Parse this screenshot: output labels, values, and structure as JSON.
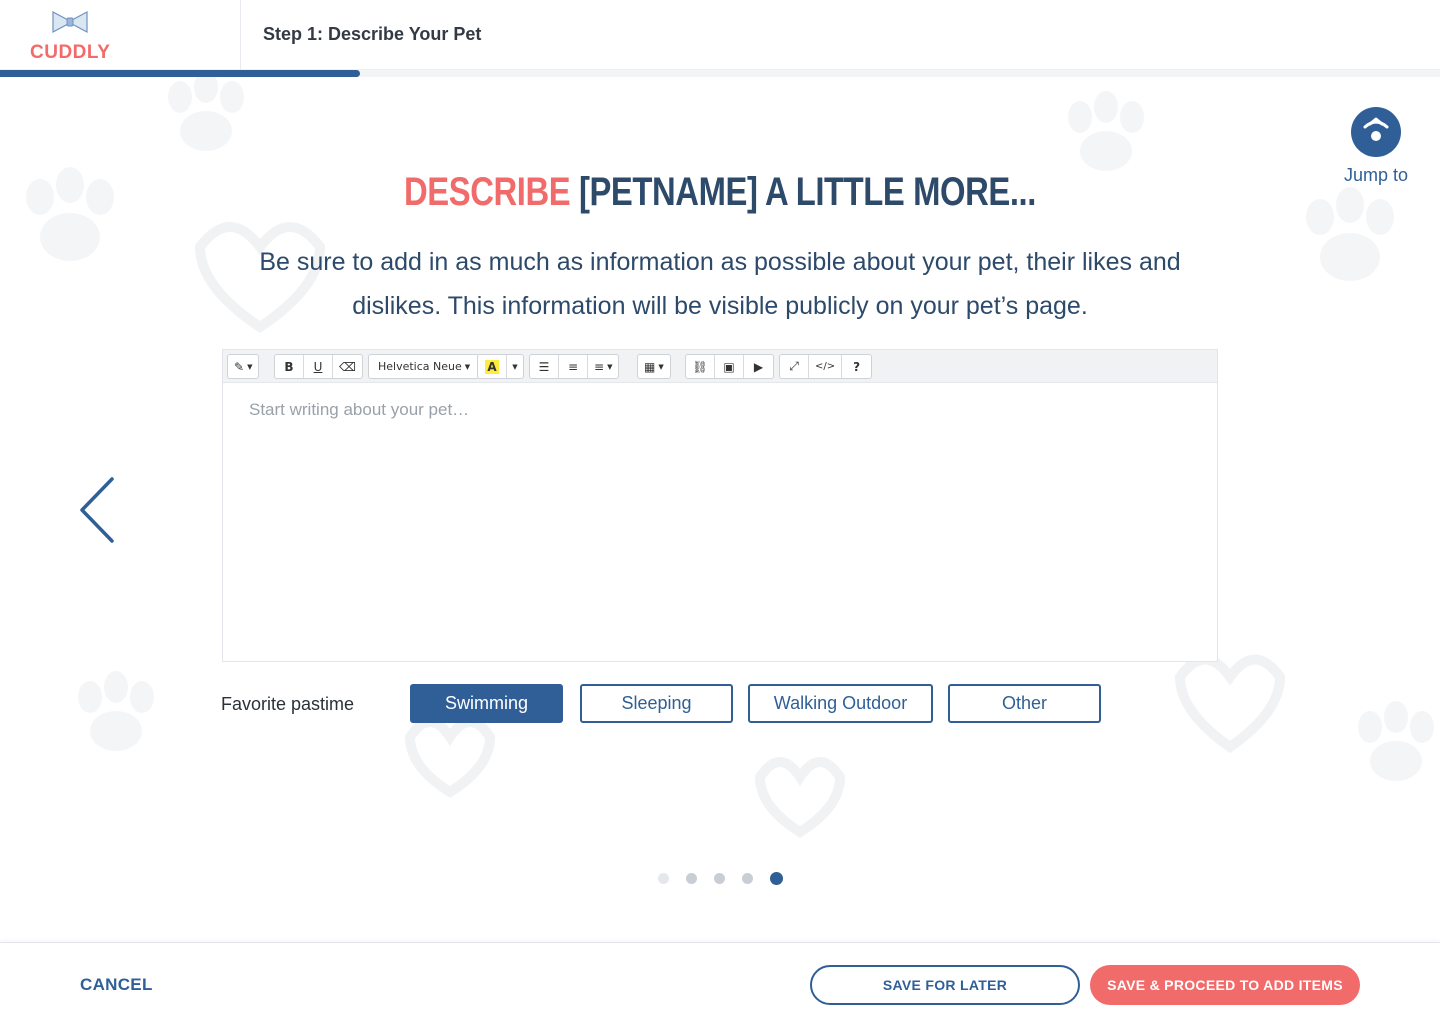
{
  "header": {
    "brand": "CUDDLY",
    "step_title": "Step 1: Describe Your Pet",
    "progress_fraction": 0.25
  },
  "jump": {
    "label": "Jump to"
  },
  "headline": {
    "accent": "DESCRIBE",
    "rest": " [PETNAME] A LITTLE MORE..."
  },
  "subtext": "Be sure to add in as much as information as possible about your pet, their likes and dislikes. This information will be visible publicly on your pet’s page.",
  "editor": {
    "placeholder": "Start writing about your pet…",
    "font_label": "Helvetica Neue",
    "toolbar_icons": [
      "magic-icon",
      "bold-icon",
      "underline-icon",
      "eraser-icon",
      "font-color-icon",
      "unordered-list-icon",
      "ordered-list-icon",
      "align-icon",
      "table-icon",
      "link-icon",
      "image-icon",
      "video-icon",
      "fullscreen-icon",
      "code-view-icon",
      "help-icon"
    ]
  },
  "pastime": {
    "label": "Favorite pastime",
    "options": [
      "Swimming",
      "Sleeping",
      "Walking Outdoor",
      "Other"
    ],
    "selected": "Swimming"
  },
  "pagination": {
    "total": 5,
    "current": 5
  },
  "footer": {
    "cancel": "CANCEL",
    "save_later": "SAVE FOR LATER",
    "proceed": "SAVE & PROCEED TO ADD ITEMS"
  },
  "colors": {
    "primary": "#2f5f96",
    "accent": "#f26b6b",
    "text_dark": "#2d4a6b"
  }
}
